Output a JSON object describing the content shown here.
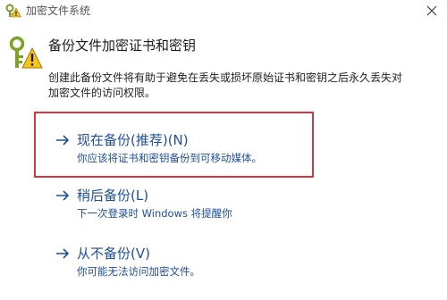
{
  "window": {
    "title": "加密文件系统",
    "title_icon": "key-warning-icon",
    "close_icon": "close-icon"
  },
  "header": {
    "icon": "key-warning-icon",
    "title": "备份文件加密证书和密钥",
    "description_lines": [
      "创建此备份文件将有助于避免在丢失或损坏原始证书和密钥之后永久丢失对",
      "加密文件的访问权限。"
    ]
  },
  "options": [
    {
      "title": "现在备份(推荐)(N)",
      "subtitle": "你应该将证书和密钥备份到可移动媒体。",
      "icon": "arrow-right-icon",
      "highlighted": true
    },
    {
      "title": "稍后备份(L)",
      "subtitle": "下一次登录时 Windows 将提醒你",
      "icon": "arrow-right-icon",
      "highlighted": false
    },
    {
      "title": "从不备份(V)",
      "subtitle": "你可能无法访问加密文件。",
      "icon": "arrow-right-icon",
      "highlighted": false
    }
  ],
  "colors": {
    "link": "#1f4e9a",
    "highlight_border": "#d9363e",
    "background": "#ffffff"
  }
}
